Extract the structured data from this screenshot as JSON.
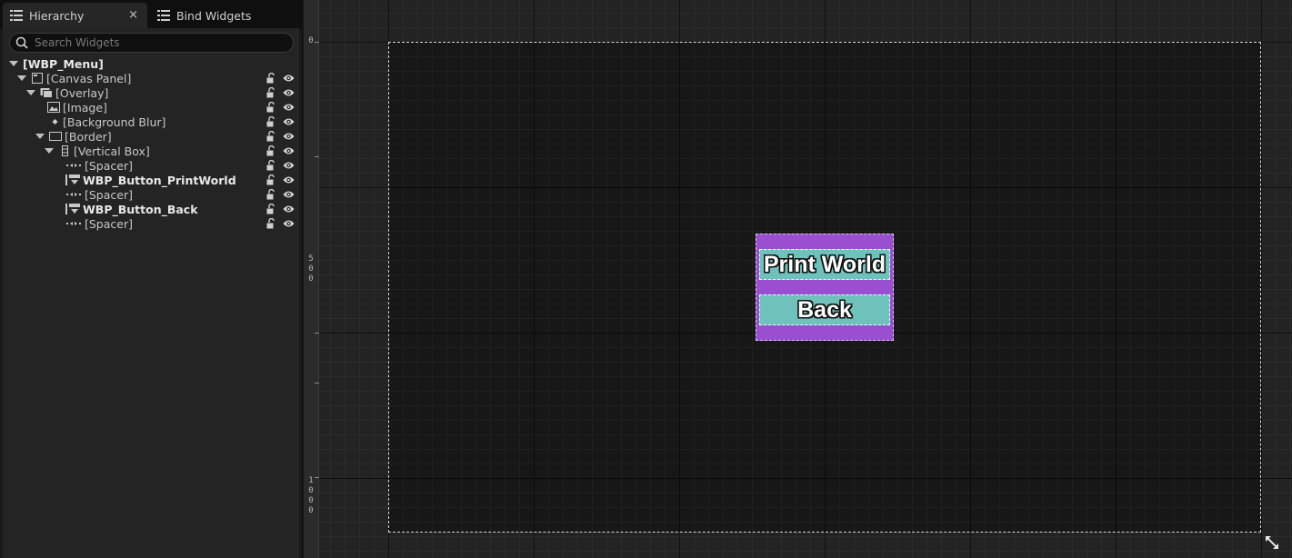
{
  "tabs": {
    "hierarchy": "Hierarchy",
    "bind_widgets": "Bind Widgets",
    "close": "×"
  },
  "search": {
    "placeholder": "Search Widgets"
  },
  "tree": [
    {
      "label": "[WBP_Menu]",
      "icon": "none",
      "bold": true,
      "expanded": true
    },
    {
      "label": "[Canvas Panel]",
      "icon": "canvas-panel-icon",
      "bold": false,
      "expanded": true
    },
    {
      "label": "[Overlay]",
      "icon": "overlay-icon",
      "bold": false,
      "expanded": true
    },
    {
      "label": "[Image]",
      "icon": "image-icon",
      "bold": false
    },
    {
      "label": "[Background Blur]",
      "icon": "diamond-icon",
      "bold": false
    },
    {
      "label": "[Border]",
      "icon": "border-icon",
      "bold": false,
      "expanded": true
    },
    {
      "label": "[Vertical Box]",
      "icon": "vertical-box-icon",
      "bold": false,
      "expanded": true
    },
    {
      "label": "[Spacer]",
      "icon": "spacer-icon",
      "bold": false
    },
    {
      "label": "WBP_Button_PrintWorld",
      "icon": "user-widget-icon",
      "bold": true
    },
    {
      "label": "[Spacer]",
      "icon": "spacer-icon",
      "bold": false
    },
    {
      "label": "WBP_Button_Back",
      "icon": "user-widget-icon",
      "bold": true
    },
    {
      "label": "[Spacer]",
      "icon": "spacer-icon",
      "bold": false
    }
  ],
  "ruler": {
    "marks": [
      "0",
      "500",
      "1000"
    ]
  },
  "designer": {
    "buttons": [
      "Print World",
      "Back"
    ]
  },
  "colors": {
    "menu_bg": "#9a4fd0",
    "button_bg": "#6fc1bb"
  }
}
